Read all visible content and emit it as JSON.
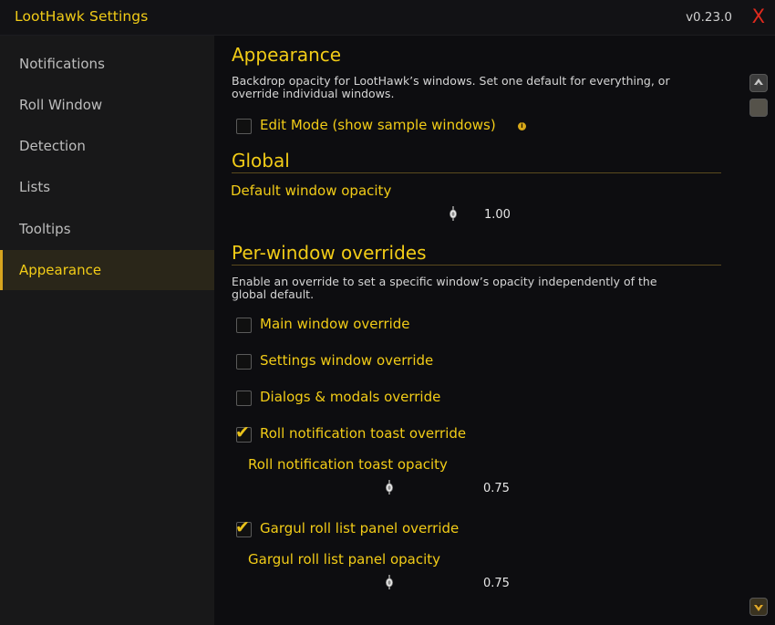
{
  "window": {
    "title": "LootHawk Settings",
    "version": "v0.23.0",
    "close_glyph": "X"
  },
  "sidebar": {
    "items": [
      {
        "label": "Notifications",
        "active": false
      },
      {
        "label": "Roll Window",
        "active": false
      },
      {
        "label": "Detection",
        "active": false
      },
      {
        "label": "Lists",
        "active": false
      },
      {
        "label": "Tooltips",
        "active": false
      },
      {
        "label": "Appearance",
        "active": true
      }
    ]
  },
  "appearance": {
    "heading": "Appearance",
    "description_line1": "Backdrop opacity for LootHawk’s windows. Set one default for everything, or",
    "description_line2": "override individual windows.",
    "edit_mode_label": "Edit Mode (show sample windows)",
    "edit_mode_checked": false,
    "info_icon": "info-icon"
  },
  "global": {
    "heading": "Global",
    "default_opacity_label": "Default window opacity",
    "default_opacity_value": "1.00"
  },
  "overrides": {
    "heading": "Per-window overrides",
    "description_line1": "Enable an override to set a specific window’s opacity independently of the",
    "description_line2": "global default.",
    "main_label": "Main window override",
    "main_checked": false,
    "settings_label": "Settings window override",
    "settings_checked": false,
    "dialogs_label": "Dialogs & modals override",
    "dialogs_checked": false,
    "toast_label": "Roll notification toast override",
    "toast_checked": true,
    "toast_opacity_label": "Roll notification toast opacity",
    "toast_opacity_value": "0.75",
    "gargul_label": "Gargul roll list panel override",
    "gargul_checked": true,
    "gargul_opacity_label": "Gargul roll list panel opacity",
    "gargul_opacity_value": "0.75"
  },
  "colors": {
    "accent": "#f2cc17",
    "close": "#e02a1e",
    "sidebar_bg": "#181819",
    "active_bg": "#2a2619"
  }
}
